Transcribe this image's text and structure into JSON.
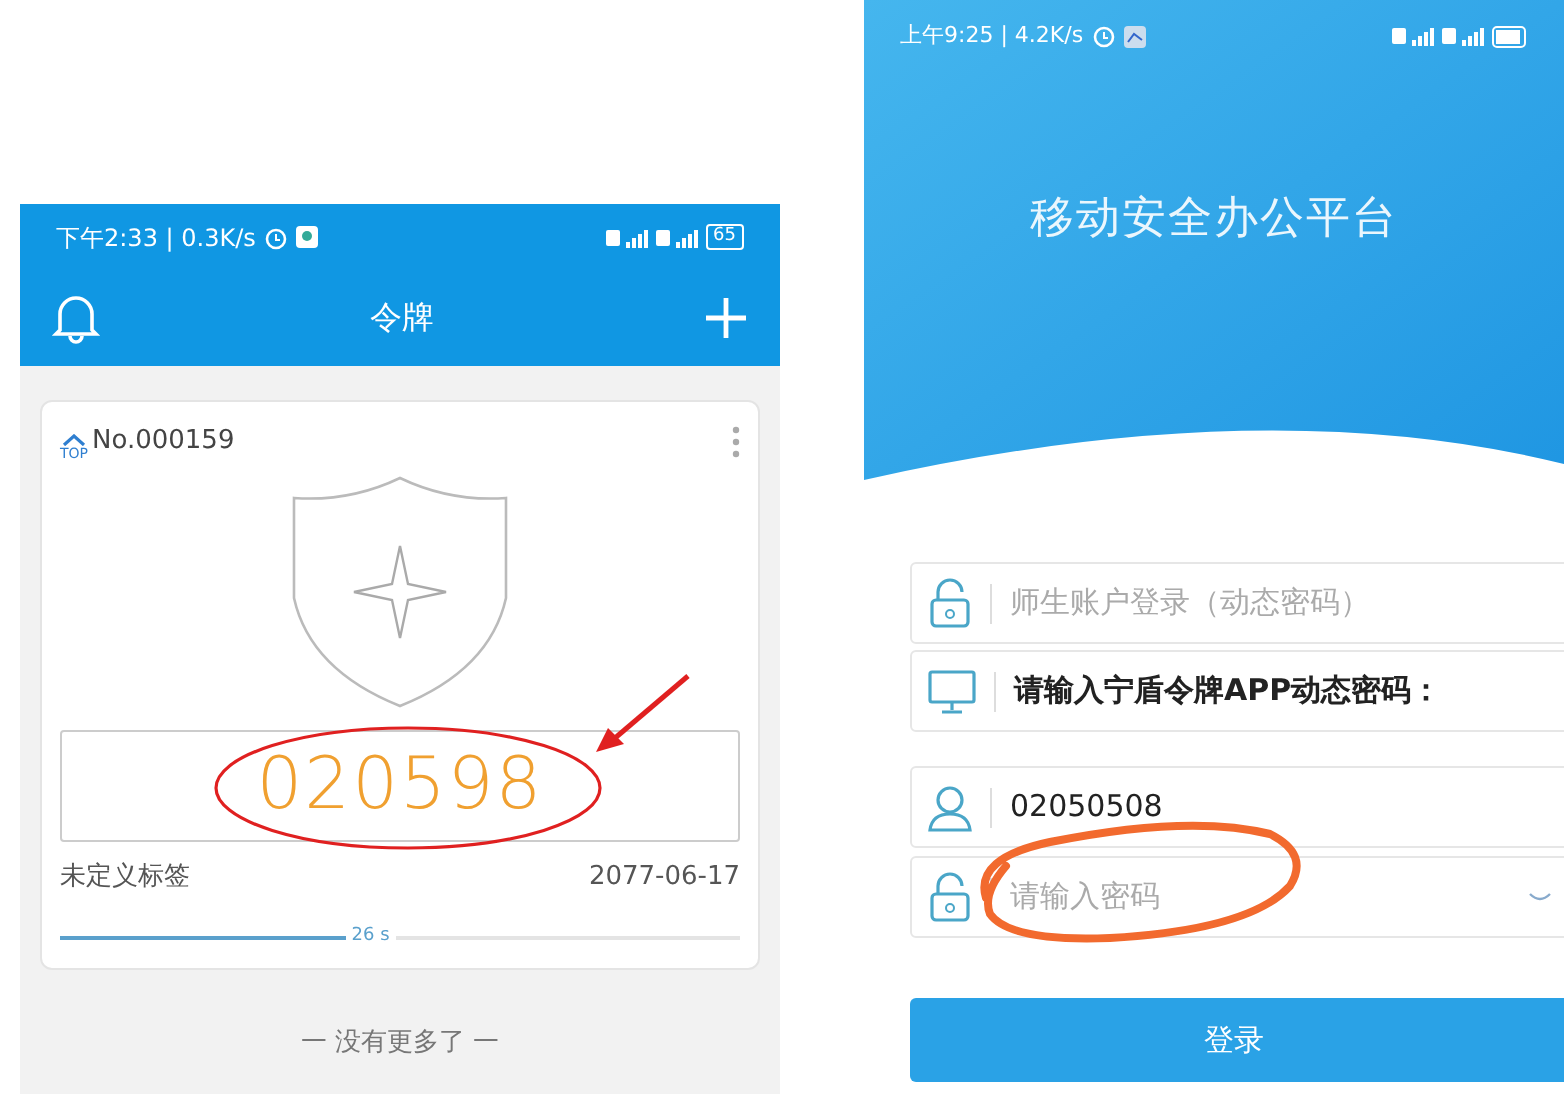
{
  "token_screen": {
    "status_bar": {
      "time": "下午2:33 | 0.3K/s",
      "battery": "65"
    },
    "header": {
      "title": "令牌"
    },
    "tokens": [
      {
        "top_badge": "TOP",
        "number": "No.000159",
        "code": "020598",
        "label": "未定义标签",
        "expiry": "2077-06-17",
        "level": 0.42,
        "countdown": "26 s"
      }
    ],
    "footer": "一 没有更多了 一"
  },
  "login_screen": {
    "status_bar": {
      "time": "上午9:25 | 4.2K/s"
    },
    "title": "移动安全办公平台",
    "fields": [
      {
        "kind": "select",
        "placeholder": "师生账户登录（动态密码）"
      },
      {
        "kind": "label",
        "text": "请输入宁盾令牌APP动态密码："
      },
      {
        "kind": "input",
        "value": "02050508"
      },
      {
        "kind": "password",
        "placeholder": "请输入密码"
      }
    ],
    "login_button": "登录"
  }
}
